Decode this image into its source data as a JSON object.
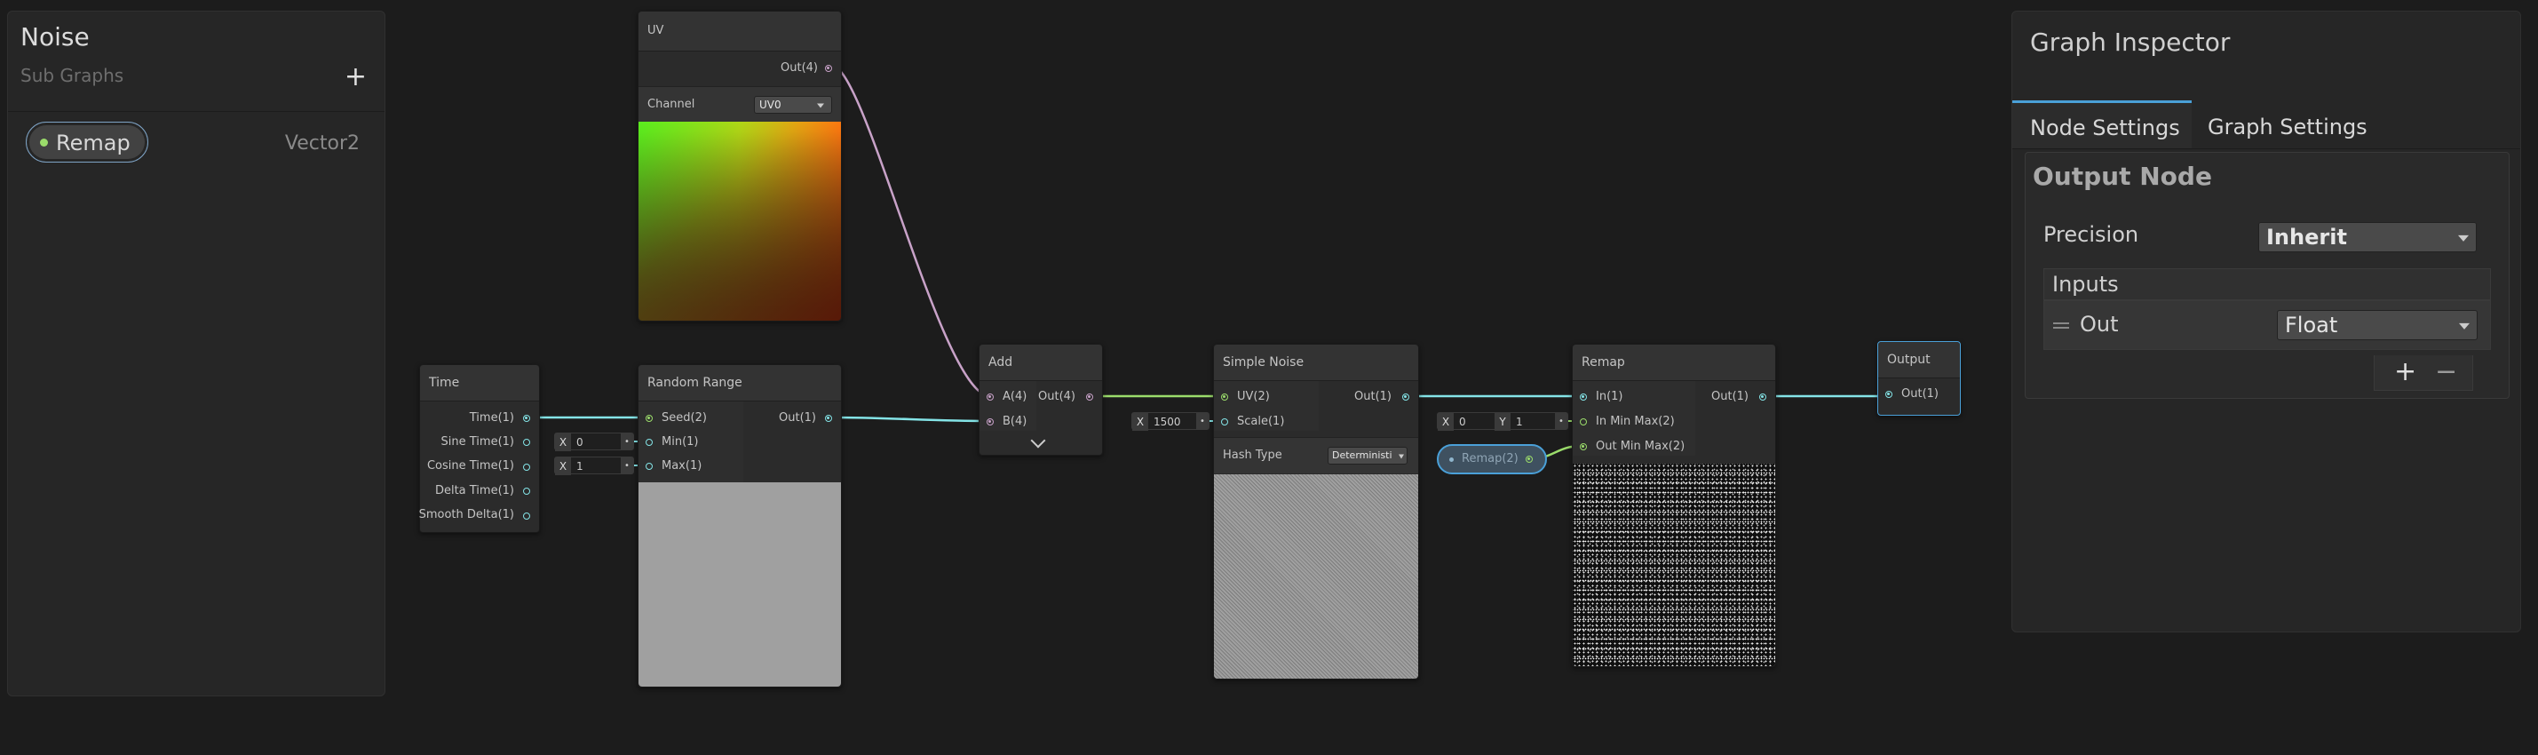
{
  "blackboard": {
    "title": "Noise",
    "subtitle": "Sub Graphs",
    "add_label": "+",
    "property": {
      "name": "Remap",
      "type": "Vector2"
    }
  },
  "inspector": {
    "title": "Graph Inspector",
    "tabs": [
      "Node Settings",
      "Graph Settings"
    ],
    "active_tab": "Node Settings",
    "section_title": "Output Node",
    "precision_label": "Precision",
    "precision_value": "Inherit",
    "inputs_header": "Inputs",
    "input_row": {
      "name": "Out",
      "type": "Float"
    },
    "add_label": "+",
    "remove_label": "−"
  },
  "nodes": {
    "uv": {
      "title": "UV",
      "out": "Out(4)",
      "channel_label": "Channel",
      "channel_value": "UV0"
    },
    "time": {
      "title": "Time",
      "outputs": [
        "Time(1)",
        "Sine Time(1)",
        "Cosine Time(1)",
        "Delta Time(1)",
        "Smooth Delta(1)"
      ]
    },
    "random_range": {
      "title": "Random Range",
      "inputs": [
        "Seed(2)",
        "Min(1)",
        "Max(1)"
      ],
      "out": "Out(1)",
      "min_x": "X",
      "min_val": "0",
      "max_x": "X",
      "max_val": "1"
    },
    "add": {
      "title": "Add",
      "inputs": [
        "A(4)",
        "B(4)"
      ],
      "out": "Out(4)"
    },
    "simple_noise": {
      "title": "Simple Noise",
      "inputs": [
        "UV(2)",
        "Scale(1)"
      ],
      "out": "Out(1)",
      "scale_x": "X",
      "scale_val": "1500",
      "hash_label": "Hash Type",
      "hash_value": "Deterministi"
    },
    "remap": {
      "title": "Remap",
      "inputs": [
        "In(1)",
        "In Min Max(2)",
        "Out Min Max(2)"
      ],
      "out": "Out(1)",
      "inminmax_x": "X",
      "inminmax_x_val": "0",
      "inminmax_y": "Y",
      "inminmax_y_val": "1"
    },
    "remap_property": {
      "label": "Remap(2)"
    },
    "output": {
      "title": "Output",
      "input": "Out(1)"
    }
  },
  "colors": {
    "float_port": "#84e4e7",
    "vector2_port": "#9bdc6b",
    "vector4_port": "#c8a2c8",
    "selection": "#4aa0d8",
    "background": "#1c1c1c"
  }
}
